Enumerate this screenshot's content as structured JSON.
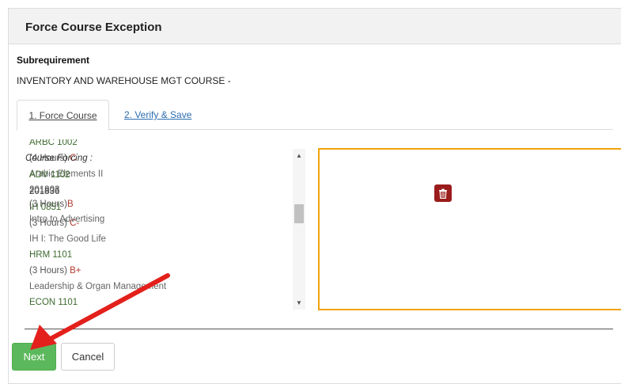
{
  "dialog": {
    "title": "Force Course Exception"
  },
  "subrequirement": {
    "heading": "Subrequirement",
    "value": "INVENTORY AND WAREHOUSE MGT COURSE -"
  },
  "tabs": [
    {
      "label": "1. Force Course",
      "active": true
    },
    {
      "label": "2. Verify & Save",
      "active": false
    }
  ],
  "course_list": {
    "entries": [
      {
        "code": "ARBC 1002",
        "hours": "(4 Hours) ",
        "grade": "C",
        "title": "Arabic Elements II"
      },
      {
        "term": "201836"
      },
      {
        "code": "IH 0851",
        "hours": "(3 Hours) ",
        "grade": "C-",
        "title": "IH I: The Good Life"
      },
      {
        "code": "HRM 1101",
        "hours": "(3 Hours) ",
        "grade": "B+",
        "title": "Leadership & Organ Management"
      },
      {
        "code": "ECON 1101"
      }
    ]
  },
  "forcing": {
    "label": "Course Forcing :",
    "code": "ADV 1102",
    "term": "201803",
    "hours": "(3 Hours)",
    "grade": "B",
    "title": "Intro to Advertising",
    "delete_icon": "trash-icon"
  },
  "buttons": {
    "next": "Next",
    "cancel": "Cancel"
  },
  "colors": {
    "accent_orange": "#f0a30a",
    "next_green": "#5cb85c",
    "delete_red": "#9b1c1c",
    "annotation_arrow": "#e3201b"
  }
}
